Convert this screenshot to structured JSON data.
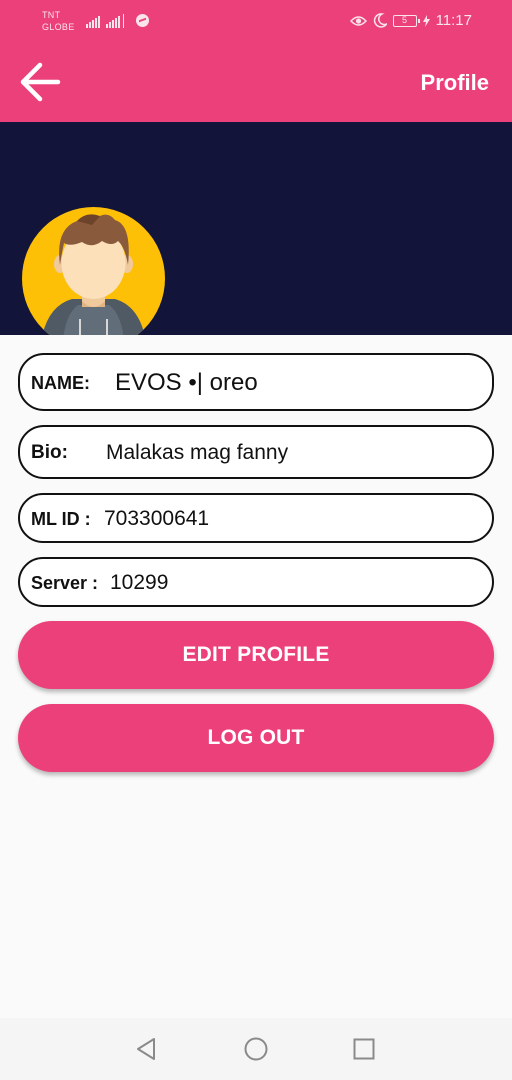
{
  "status_bar": {
    "carrier_line1": "TNT",
    "carrier_line2": "GLOBE",
    "battery_level": "5",
    "time": "11:17",
    "icons": [
      "signal-icon",
      "signal-4g-icon",
      "messenger-icon",
      "eye-icon",
      "moon-icon",
      "battery-icon",
      "charging-icon"
    ]
  },
  "app_bar": {
    "back_icon": "arrow-left-icon",
    "title": "Profile",
    "background": "#ec407a"
  },
  "header": {
    "background": "#13143a",
    "avatar_background": "#fec007",
    "avatar_icon": "user-avatar-icon"
  },
  "fields": {
    "name": {
      "label": "NAME:",
      "value": "EVOS •| oreo"
    },
    "bio": {
      "label": "Bio:",
      "value": "Malakas mag fanny"
    },
    "ml_id": {
      "label": "ML ID :",
      "value": "703300641"
    },
    "server": {
      "label": "Server :",
      "value": "10299"
    }
  },
  "buttons": {
    "edit_profile": "EDIT PROFILE",
    "log_out": "LOG OUT"
  },
  "nav_bar": {
    "icons": [
      "back-triangle-icon",
      "home-circle-icon",
      "recents-square-icon"
    ]
  }
}
